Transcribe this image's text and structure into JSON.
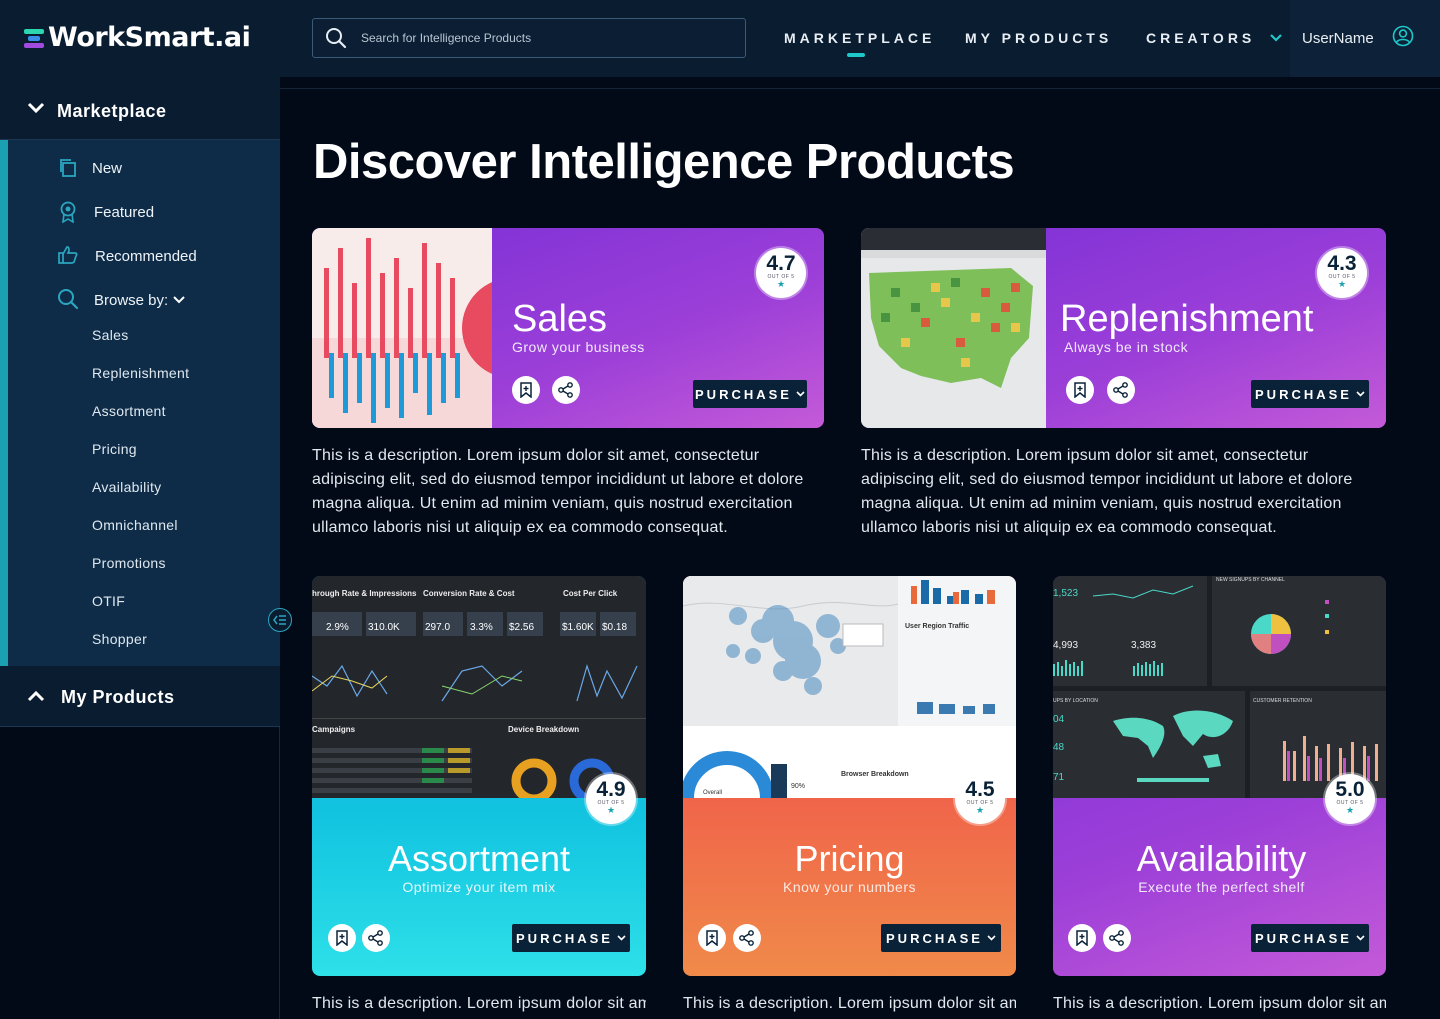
{
  "brand": {
    "name": "WorkSmart.ai"
  },
  "search": {
    "placeholder": "Search for Intelligence Products"
  },
  "nav": {
    "marketplace": "MARKETPLACE",
    "my_products": "MY PRODUCTS",
    "creators": "CREATORS",
    "username": "UserName"
  },
  "sidebar": {
    "marketplace_label": "Marketplace",
    "items": [
      {
        "label": "New",
        "icon": "copy-icon"
      },
      {
        "label": "Featured",
        "icon": "award-icon"
      },
      {
        "label": "Recommended",
        "icon": "thumbs-up-icon"
      },
      {
        "label": "Browse by:",
        "icon": "search-icon"
      }
    ],
    "browse": [
      "Sales",
      "Replenishment",
      "Assortment",
      "Pricing",
      "Availability",
      "Omnichannel",
      "Promotions",
      "OTIF",
      "Shopper"
    ],
    "my_products_label": "My Products"
  },
  "main": {
    "title": "Discover Intelligence Products",
    "purchase_label": "PURCHASE",
    "rating_of": "OUT OF 5",
    "description": "This is a description. Lorem ipsum dolor sit amet, consectetur adipiscing elit, sed do eiusmod tempor incididunt ut labore et dolore magna aliqua. Ut enim ad minim veniam, quis nostrud exercitation ullamco laboris nisi ut aliquip ex ea commodo consequat.",
    "description_short": "This is a description. Lorem ipsum dolor sit amet,",
    "products": [
      {
        "title": "Sales",
        "subtitle": "Grow your business",
        "rating": "4.7"
      },
      {
        "title": "Replenishment",
        "subtitle": "Always be in stock",
        "rating": "4.3"
      },
      {
        "title": "Assortment",
        "subtitle": "Optimize your item mix",
        "rating": "4.9"
      },
      {
        "title": "Pricing",
        "subtitle": "Know your numbers",
        "rating": "4.5"
      },
      {
        "title": "Availability",
        "subtitle": "Execute the perfect shelf",
        "rating": "5.0"
      }
    ],
    "thumb_text": {
      "assortment": [
        "hrough Rate & Impressions",
        "Conversion Rate & Cost",
        "Cost Per Click",
        "Campaigns",
        "Device Breakdown"
      ],
      "assortment_kpis": [
        "2.9%",
        "310.0K",
        "297.0",
        "3.3%",
        "$2.56",
        "$1.60K",
        "$0.18"
      ],
      "pricing": [
        "User Region Traffic",
        "Browser Breakdown",
        "Overall",
        "90%"
      ],
      "availability": [
        "1,523",
        "NEW SIGNUPS BY CHANNEL",
        "4,993",
        "3,383",
        "UPS BY LOCATION",
        "CUSTOMER RETENTION",
        "04",
        "48",
        "71"
      ]
    }
  },
  "colors": {
    "accent": "#1ec8c8",
    "purple": "#8a3ad8",
    "navy": "#0a2238"
  }
}
